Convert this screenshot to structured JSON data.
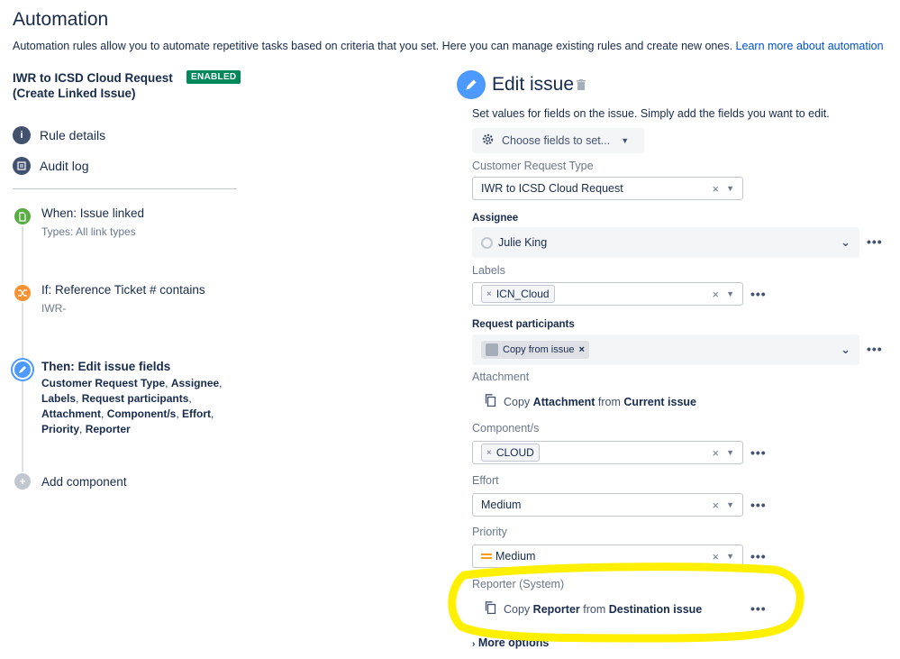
{
  "header": {
    "title": "Automation",
    "description": "Automation rules allow you to automate repetitive tasks based on criteria that you set. Here you can manage existing rules and create new ones.",
    "learn_more": "Learn more about automation"
  },
  "rule": {
    "name_line1": "IWR to ICSD Cloud Request",
    "name_line2": "(Create Linked Issue)",
    "status": "ENABLED"
  },
  "sidebar": {
    "rule_details": "Rule details",
    "audit_log": "Audit log"
  },
  "steps": {
    "when": {
      "title": "When: Issue linked",
      "sub": "Types: All link types"
    },
    "if": {
      "title": "If: Reference Ticket # contains",
      "sub": "IWR-"
    },
    "then": {
      "title": "Then: Edit issue fields",
      "fields": [
        "Customer Request Type",
        "Assignee",
        "Labels",
        "Request participants",
        "Attachment",
        "Component/s",
        "Effort",
        "Priority",
        "Reporter"
      ]
    },
    "add": "Add component"
  },
  "edit": {
    "title": "Edit issue",
    "description": "Set values for fields on the issue. Simply add the fields you want to edit.",
    "choose_fields": "Choose fields to set...",
    "crt_label": "Customer Request Type",
    "crt_value": "IWR to ICSD Cloud Request",
    "assignee_label": "Assignee",
    "assignee_value": "Julie King",
    "labels_label": "Labels",
    "labels_tag": "ICN_Cloud",
    "participants_label": "Request participants",
    "participants_chip": "Copy from issue",
    "attachment_label": "Attachment",
    "attachment_copy": "Copy",
    "attachment_field": "Attachment",
    "attachment_from": "from",
    "attachment_source": "Current issue",
    "component_label": "Component/s",
    "component_tag": "CLOUD",
    "effort_label": "Effort",
    "effort_value": "Medium",
    "priority_label": "Priority",
    "priority_value": "Medium",
    "reporter_label": "Reporter (System)",
    "reporter_copy": "Copy",
    "reporter_field": "Reporter",
    "reporter_from": "from",
    "reporter_source": "Destination issue",
    "more_options": "More options"
  },
  "colors": {
    "enabled_badge": "#00875a",
    "when_icon": "#5aac44",
    "if_icon": "#f79232",
    "then_icon": "#4c9aff",
    "highlight": "#ffef00"
  },
  "icons": [
    "info-icon",
    "audit-log-icon",
    "trigger-icon",
    "condition-icon",
    "pencil-icon",
    "plus-icon",
    "trash-icon",
    "gear-icon",
    "copy-icon",
    "chevron-down-icon",
    "more-icon",
    "priority-medium-icon"
  ]
}
